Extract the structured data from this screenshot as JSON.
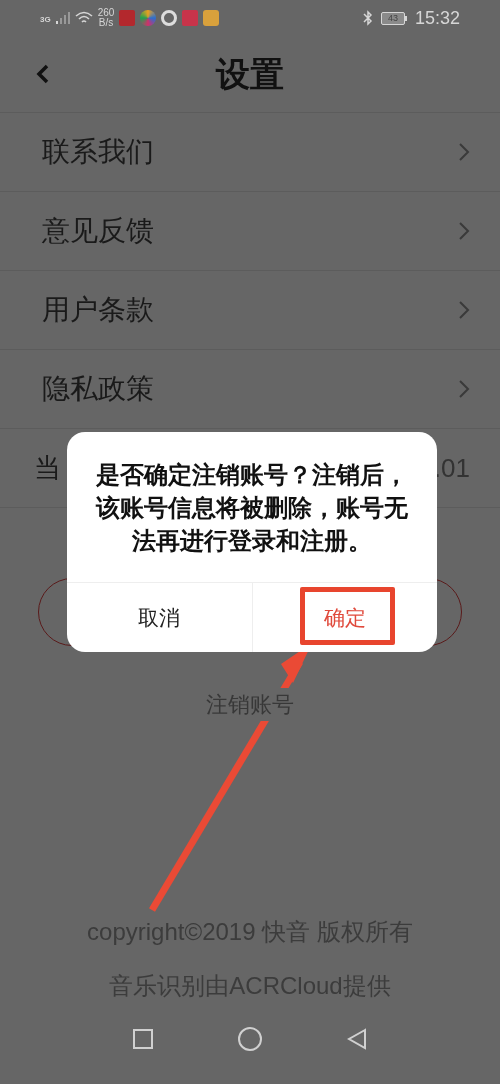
{
  "status_bar": {
    "network": "3G",
    "speed": "260",
    "speed_unit": "B/s",
    "battery": "43",
    "time": "15:32"
  },
  "nav": {
    "title": "设置"
  },
  "menu": [
    {
      "label": "联系我们"
    },
    {
      "label": "意见反馈"
    },
    {
      "label": "用户条款"
    },
    {
      "label": "隐私政策"
    }
  ],
  "version_row": {
    "label": "当",
    "value": ".01"
  },
  "deregister_link": "注销账号",
  "footer": [
    "copyright©2019 快音 版权所有",
    "音乐识别由ACRCloud提供"
  ],
  "dialog": {
    "message": "是否确定注销账号？注销后，该账号信息将被删除，账号无法再进行登录和注册。",
    "buttons": [
      {
        "label": "取消",
        "kind": "cancel"
      },
      {
        "label": "确定",
        "kind": "confirm"
      }
    ]
  }
}
